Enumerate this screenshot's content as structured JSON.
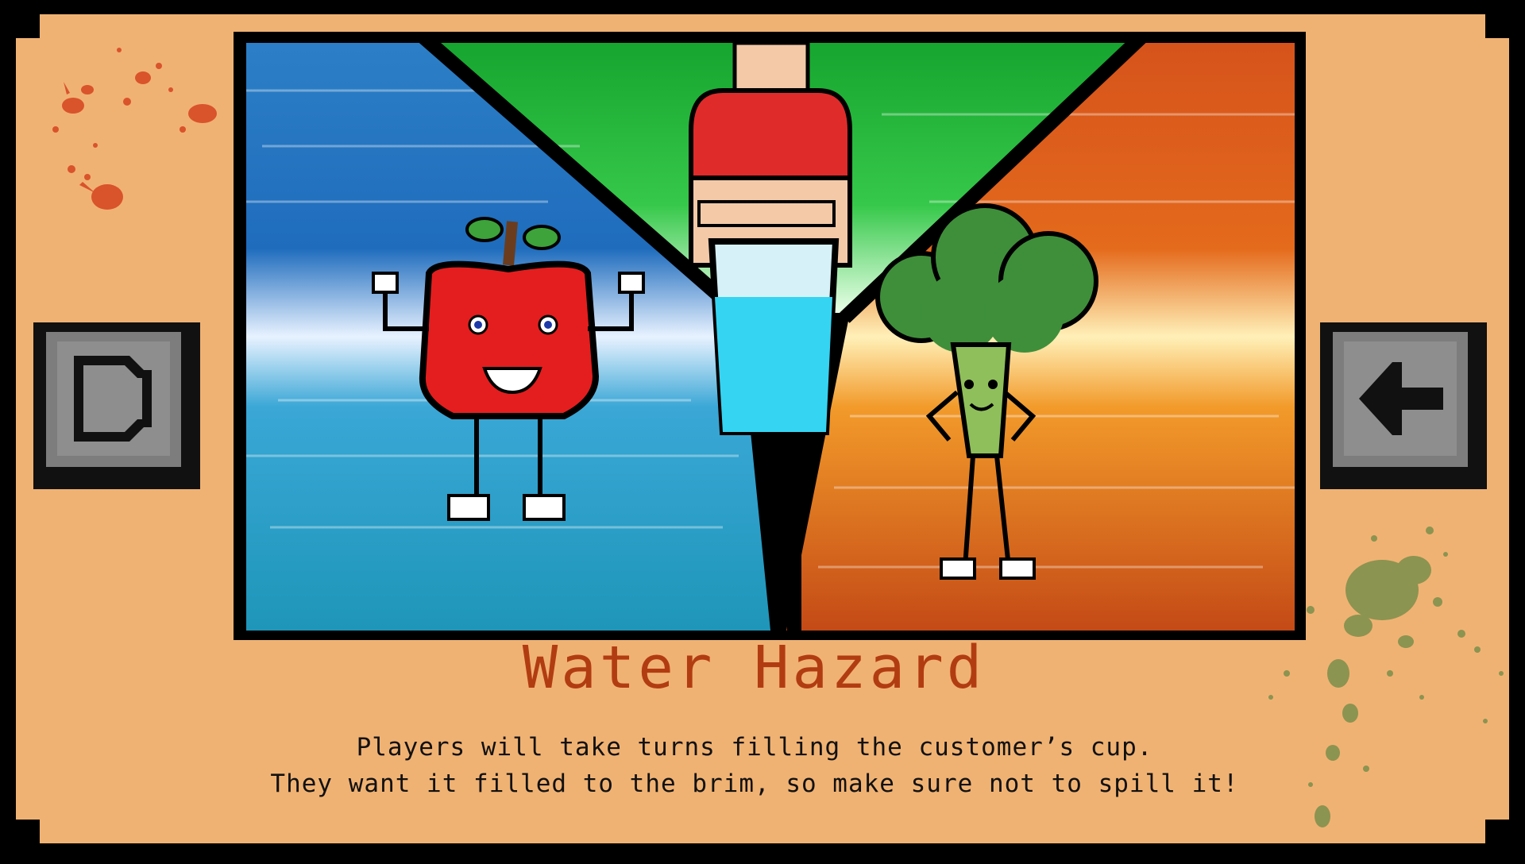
{
  "game": {
    "mode_title": "Water Hazard",
    "description_lines": [
      "Players will take turns filling the customer’s cup.",
      "They want it filled to the brim, so make sure not to spill it!"
    ]
  },
  "buttons": {
    "left_icon": "d-shaped-icon",
    "right_icon": "back-arrow-icon"
  },
  "colors": {
    "panel": "#f0b273",
    "title": "#b23c12",
    "button_face": "#8e8e8e",
    "blue_zone": "#2f86c8",
    "green_zone": "#1fb33a",
    "orange_zone": "#e0651c"
  }
}
